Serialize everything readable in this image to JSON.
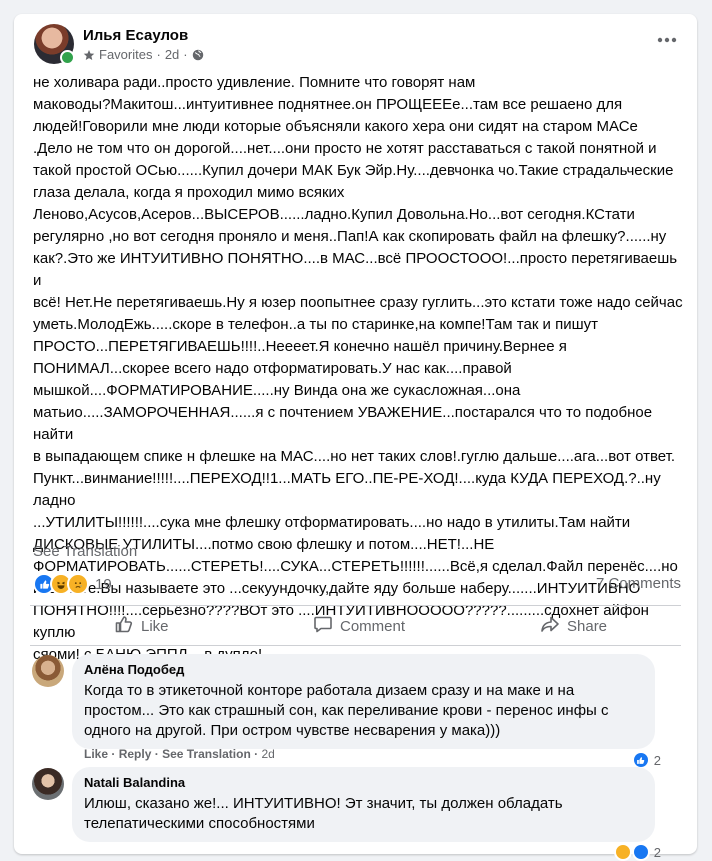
{
  "post": {
    "author": "Илья Есаулов",
    "meta_favorites": "Favorites",
    "meta_time": "2d",
    "text": "не холивара ради..просто удивление. Помните что говорят нам\nмаководы?Макитош...интуитивнее поднятнее.он ПРОЩЕЕЕе...там все решаено для\nлюдей!Говорили мне люди которые объясняли какого хера они сидят на старом МАСе\n.Дело не том что он дорогой....нет....они просто не хотят расставаться с такой понятной и\nтакой простой ОСью......Купил дочери МАК Бук Эйр.Ну....девчонка чо.Такие страдальческие\nглаза делала, когда я проходил мимо всяких\nЛеново,Асусов,Асеров...ВЫСЕРОВ......ладно.Купил Довольна.Но...вот сегодня.КСтати\nрегулярно ,но вот сегодня проняло и меня..Пап!А как скопировать файл на флешку?......ну\nкак?.Это же ИНТУИТИВНО ПОНЯТНО....в МАС...всё ПРООСТООО!...просто перетягиваешь и\nвсё! Нет.Не перетягиваешь.Ну я юзер поопытнее сразу гуглить...это кстати тоже надо сейчас\nуметь.МолодЕжь.....скоре в телефон..а ты по старинке,на компе!Там так и пишут\nПРОСТО...ПЕРЕТЯГИВАЕШЬ!!!!..Нееeет.Я конечно нашёл причину.Вернее я\nПОНИМАЛ...скорее всего надо отформатировать.У нас как....правой\nмышкой....ФОРМАТИРОВАНИЕ.....ну Винда она же сукасложная...она\nматьио.....ЗАМОРОЧЕННАЯ......я с почтением УВАЖЕНИЕ...постарался что то подобное найти\nв выпадающем спике н флешке на МАС....но нет таких слов!.гуглю дальше....ага...вот ответ.\nПункт...винмание!!!!!....ПЕРЕХОД!!1...МАТЬ ЕГО..ПЕ-РЕ-ХОД!....куда КУДА ПЕРЕХОД.?..ну ладно\n...УТИЛИТЫ!!!!!!....сука мне флешку отформатировать....но надо в утилиты.Там найти\nДИСКОВЫЕ УТИЛИТЫ....потмо свою флешку и потом....НЕТ!...НЕ\nФОРМАТИРОВАТЬ......СТЕРЕТЬ!....СУКА...СТЕРЕТЬ!!!!!!......Всё,я сделал.Файл перенёс....но\nизвините.Вы называете это ...секуундочку,дайте яду больше наберу.......ИНТУИТИВНО\nПОНЯТНО!!!!....серьёзно????ВОт это ....ИНТУИТИВНООООО?????.........сдохнет айфон куплю\nсяоми! с БАНЮ ЭППЛ....в  дупло!",
    "see_translation": "See Translation",
    "reaction_count": "19",
    "comments_count": "7 Comments",
    "reaction_icons": [
      "like-icon",
      "haha-icon",
      "sad-icon"
    ]
  },
  "actions": {
    "like": "Like",
    "comment": "Comment",
    "share": "Share"
  },
  "comments": [
    {
      "author": "Алёна Подобед",
      "text": "Когда то в этикеточной конторе работала дизаем сразу и на маке и на\nпростом... Это как страшный сон, как переливание крови - перенос инфы с\nодного на другой. При остром чувстве несварения у мака)))",
      "like": "Like",
      "reply": "Reply",
      "see_translation": "See Translation",
      "time": "2d",
      "reaction_count": "2"
    },
    {
      "author": "Natali Balandina",
      "text": "Илюш, сказано же!... ИНТУИТИВНО! Эт значит, ты должен обладать\nтелепатическими способностями",
      "reaction_count": "2"
    }
  ],
  "colors": {
    "like_blue": "#1877f2",
    "haha_yellow": "#f7b125",
    "online_green": "#31a24c",
    "secondary_text": "#65676b"
  }
}
